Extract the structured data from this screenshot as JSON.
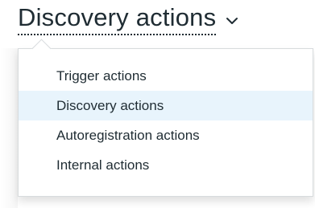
{
  "header": {
    "title": "Discovery actions",
    "chevron_icon": "chevron-down-icon"
  },
  "menu": {
    "selected_index": 1,
    "items": [
      {
        "label": "Trigger actions"
      },
      {
        "label": "Discovery actions"
      },
      {
        "label": "Autoregistration actions"
      },
      {
        "label": "Internal actions"
      }
    ]
  },
  "colors": {
    "text": "#1f2c33",
    "selected_bg": "#e8f4fc",
    "border": "#d7dbdd"
  }
}
